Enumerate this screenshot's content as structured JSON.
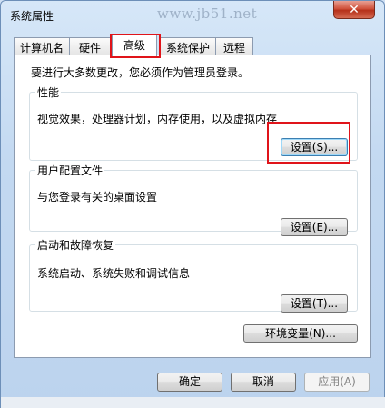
{
  "window": {
    "title": "系统属性",
    "watermark": "www.jb51.net",
    "close_glyph": "✕"
  },
  "tabs": [
    {
      "label": "计算机名",
      "active": false
    },
    {
      "label": "硬件",
      "active": false
    },
    {
      "label": "高级",
      "active": true
    },
    {
      "label": "系统保护",
      "active": false
    },
    {
      "label": "远程",
      "active": false
    }
  ],
  "advanced": {
    "admin_note": "要进行大多数更改，您必须作为管理员登录。",
    "performance": {
      "title": "性能",
      "description": "视觉效果，处理器计划，内存使用，以及虚拟内存",
      "button": "设置(S)..."
    },
    "user_profiles": {
      "title": "用户配置文件",
      "description": "与您登录有关的桌面设置",
      "button": "设置(E)..."
    },
    "startup_recovery": {
      "title": "启动和故障恢复",
      "description": "系统启动、系统失败和调试信息",
      "button": "设置(T)..."
    },
    "env_button": "环境变量(N)..."
  },
  "footer": {
    "ok": "确定",
    "cancel": "取消",
    "apply": "应用(A)"
  },
  "colors": {
    "highlight": "#e0141a",
    "window_frame": "#bcd3ee"
  }
}
